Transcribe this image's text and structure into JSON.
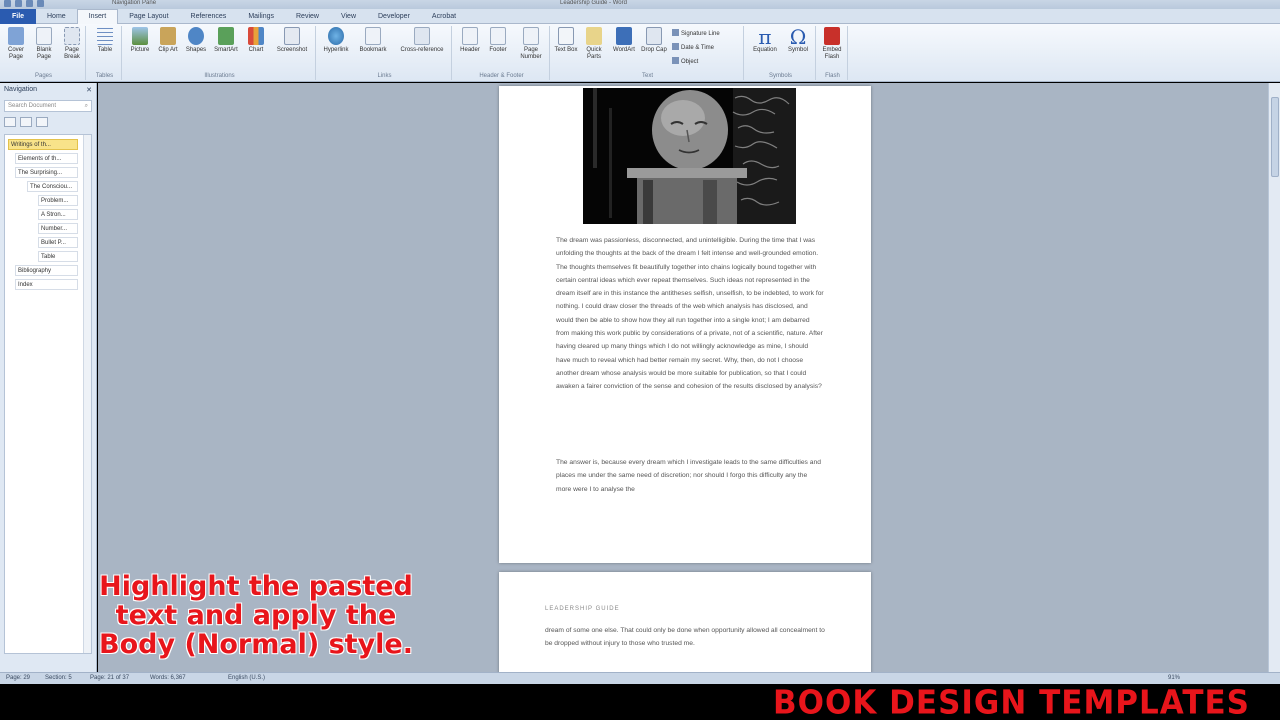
{
  "title_bar": {
    "context_tab": "Navigation Pane",
    "window_title": "Leadership Guide - Word"
  },
  "tabs": {
    "file": "File",
    "items": [
      "Home",
      "Insert",
      "Page Layout",
      "References",
      "Mailings",
      "Review",
      "View",
      "Developer",
      "Acrobat"
    ],
    "active": "Insert"
  },
  "ribbon": {
    "pages": {
      "label": "Pages",
      "buttons": [
        "Cover Page",
        "Blank Page",
        "Page Break"
      ]
    },
    "tables": {
      "label": "Tables",
      "buttons": [
        "Table"
      ]
    },
    "illustrations": {
      "label": "Illustrations",
      "buttons": [
        "Picture",
        "Clip Art",
        "Shapes",
        "SmartArt",
        "Chart",
        "Screenshot"
      ]
    },
    "links": {
      "label": "Links",
      "buttons": [
        "Hyperlink",
        "Bookmark",
        "Cross-reference"
      ]
    },
    "header_footer": {
      "label": "Header & Footer",
      "buttons": [
        "Header",
        "Footer",
        "Page Number"
      ]
    },
    "text": {
      "label": "Text",
      "buttons": [
        "Text Box",
        "Quick Parts",
        "WordArt",
        "Drop Cap"
      ],
      "small": [
        "Signature Line",
        "Date & Time",
        "Object"
      ]
    },
    "symbols": {
      "label": "Symbols",
      "buttons": [
        "Equation",
        "Symbol"
      ]
    },
    "flash": {
      "label": "Flash",
      "buttons": [
        "Embed Flash"
      ]
    }
  },
  "nav": {
    "title": "Navigation",
    "search_placeholder": "Search Document",
    "items": [
      "Writings of th...",
      "Elements of th...",
      "The Surprising...",
      "The Consciou...",
      "Problem...",
      "A Stron...",
      "Number...",
      "Bullet P...",
      "Table",
      "Bibliography",
      "Index"
    ]
  },
  "document": {
    "para1": "The dream was passionless, disconnected, and unintelligible. During the time that I was unfolding the thoughts at the back of the dream I felt intense and well-grounded emotion. The thoughts themselves fit beautifully together into chains logically bound together with certain central ideas which ever repeat themselves. Such ideas not represented in the dream itself are in this instance the antitheses selfish, unselfish, to be indebted, to work for nothing. I could draw closer the threads of the web which analysis has disclosed, and would then be able to show how they all run together into a single knot; I am debarred from making this work public by considerations of a private, not of a scientific, nature. After having cleared up many things which I do not willingly acknowledge as mine, I should have much to reveal which had better remain my secret. Why, then, do not I choose another dream whose analysis would be more suitable for publication, so that I could awaken a fairer conviction of the sense and cohesion of the results disclosed by analysis?",
    "para2": "The answer is, because every dream which I investigate leads to the same difficulties and places me under the same need of discretion; nor should I forgo this difficulty any the more were I to analyse the",
    "page2_header": "LEADERSHIP GUIDE",
    "page2_para": "dream of some one else. That could only be done when opportunity allowed all concealment to be dropped without injury to those who trusted me."
  },
  "status_bar": {
    "page": "Page: 29",
    "section": "Section: 5",
    "page_of": "Page: 21 of 37",
    "words": "Words: 6,367",
    "language": "English (U.S.)",
    "zoom": "91%"
  },
  "caption": "Highlight the pasted text and apply the Body (Normal) style.",
  "banner": "BOOK DESIGN TEMPLATES"
}
